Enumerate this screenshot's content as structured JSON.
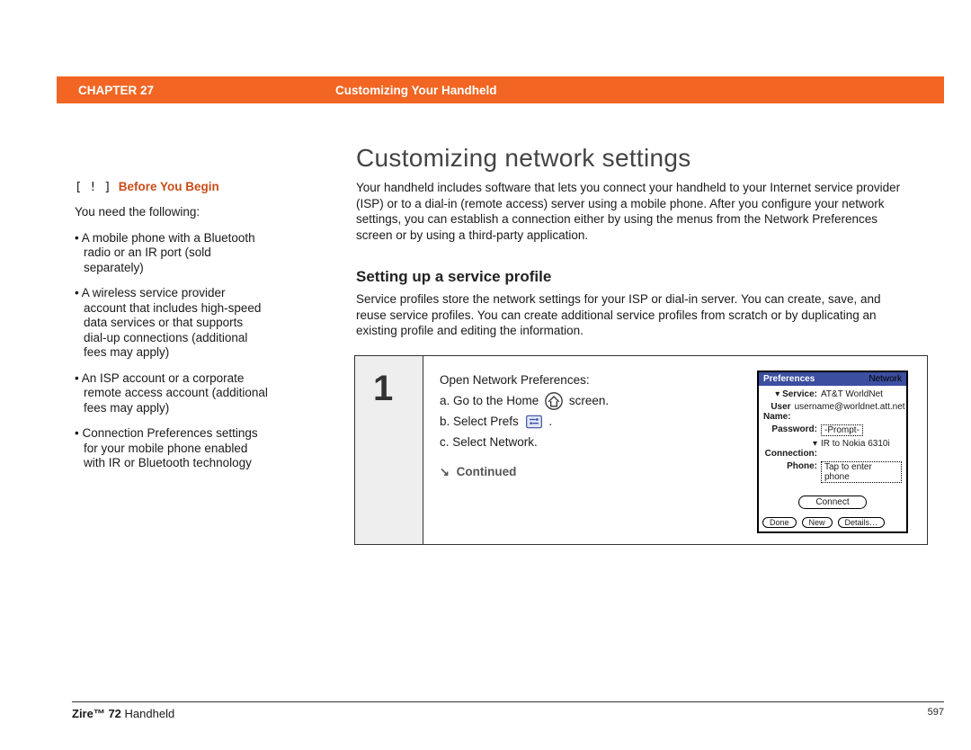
{
  "header": {
    "chapter_label": "CHAPTER 27",
    "title": "Customizing Your Handheld"
  },
  "sidebar": {
    "before_begin_label": "Before You Begin",
    "intro": "You need the following:",
    "items": [
      "A mobile phone with a Bluetooth radio or an IR port (sold separately)",
      "A wireless service provider account that includes high-speed data services or that supports dial-up connections (additional fees may apply)",
      "An ISP account or a corporate remote access account (additional fees may apply)",
      "Connection Preferences settings for your mobile phone enabled with IR or Bluetooth technology"
    ]
  },
  "main": {
    "h1": "Customizing network settings",
    "intro": "Your handheld includes software that lets you connect your handheld to your Internet service provider (ISP) or to a dial-in (remote access) server using a mobile phone. After you configure your network settings, you can establish a connection either by using the menus from the Network Preferences screen or by using a third-party application.",
    "h2": "Setting up a service profile",
    "subintro": "Service profiles store the network settings for your ISP or dial-in server. You can create, save, and reuse service profiles. You can create additional service profiles from scratch or by duplicating an existing profile and editing the information."
  },
  "step": {
    "number": "1",
    "lead": "Open Network Preferences:",
    "a_pre": "a.  Go to the Home",
    "a_post": "screen.",
    "b_pre": "b.  Select Prefs",
    "b_post": ".",
    "c": "c.  Select Network.",
    "continued": "Continued"
  },
  "palm": {
    "title": "Preferences",
    "category": "Network",
    "service_label": "Service:",
    "service_value": "AT&T WorldNet",
    "username_label": "User Name:",
    "username_value": "username@worldnet.att.net",
    "password_label": "Password:",
    "password_value": "-Prompt-",
    "connection_label": "Connection:",
    "connection_value": "IR to Nokia 6310i",
    "phone_label": "Phone:",
    "phone_value": "Tap to enter phone",
    "connect_btn": "Connect",
    "done_btn": "Done",
    "new_btn": "New",
    "details_btn": "Details…"
  },
  "footer": {
    "product_bold": "Zire™ 72",
    "product_rest": " Handheld",
    "page": "597"
  }
}
